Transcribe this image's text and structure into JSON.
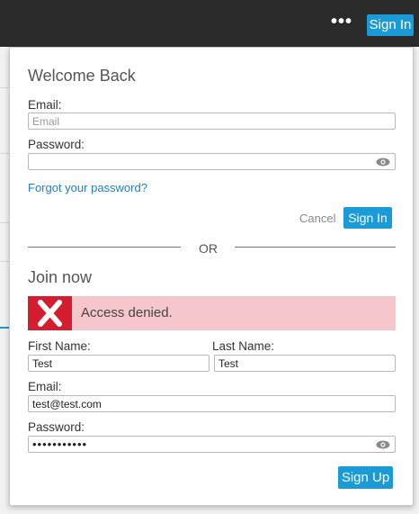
{
  "topbar": {
    "more_label": "•••",
    "signin_label": "Sign In"
  },
  "signin": {
    "title": "Welcome Back",
    "email_label": "Email:",
    "email_placeholder": "Email",
    "email_value": "",
    "password_label": "Password:",
    "password_value": "",
    "forgot_label": "Forgot your password?",
    "cancel_label": "Cancel",
    "submit_label": "Sign In"
  },
  "divider": {
    "label": "OR"
  },
  "join": {
    "title": "Join now",
    "alert": {
      "text": "Access denied.",
      "color": "#d61c2f"
    },
    "first_name_label": "First Name:",
    "first_name_value": "Test",
    "last_name_label": "Last Name:",
    "last_name_value": "Test",
    "email_label": "Email:",
    "email_value": "test@test.com",
    "password_label": "Password:",
    "password_value": "•••••••••••",
    "submit_label": "Sign Up"
  },
  "colors": {
    "accent": "#1a9ad6",
    "error_bg": "#f5c6cb",
    "topbar": "#2b2b2b"
  },
  "icons": {
    "password_toggle": "eye-icon",
    "alert": "close-icon"
  }
}
